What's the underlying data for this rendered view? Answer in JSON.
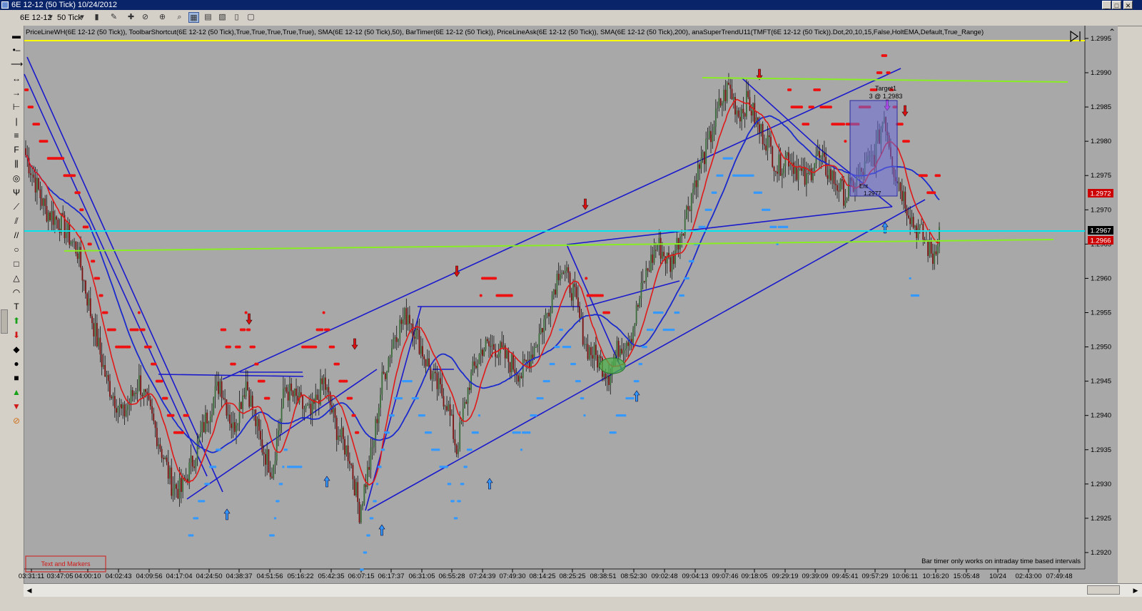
{
  "window": {
    "title": "6E 12-12 (50 Tick)  10/24/2012",
    "controls": [
      "_",
      "□",
      "✕"
    ]
  },
  "toolbar": {
    "instrument": "6E 12-12",
    "interval": "50 Tick"
  },
  "indicator_legend": "PriceLineWH(6E 12-12 (50 Tick)), ToolbarShortcut(6E 12-12 (50 Tick),True,True,True,True,True), SMA(6E 12-12 (50 Tick),50), BarTimer(6E 12-12 (50 Tick)), PriceLineAsk(6E 12-12 (50 Tick)), SMA(6E 12-12 (50 Tick),200), anaSuperTrendU11(TMFT(6E 12-12 (50 Tick)).Dot,20,10,15,False,HoltEMA,Default,True_Range)",
  "bar_timer_message": "Bar timer only works on intraday time based intervals",
  "text_markers_box": "Text and Markers",
  "trade_marker": {
    "label": "Target1",
    "detail": "3 @ 1.2983"
  },
  "entry_marker": {
    "label": "Ent",
    "detail": "1.2977"
  },
  "colors": {
    "background": "#a8a8a8",
    "bull_bar": "#3a6b3a",
    "bear_bar": "#7a1010",
    "sma50": "#e01818",
    "sma200": "#1a2acc",
    "supertrend_down": "#ee1111",
    "supertrend_up": "#3399ff",
    "ask_line": "#00e5ee",
    "lime_line": "#88ee22",
    "yellow_line": "#ffff00",
    "trendline": "#1a1acc"
  },
  "chart_data": {
    "type": "candlestick",
    "instrument": "6E 12-12",
    "interval": "50 Tick",
    "y_axis": {
      "ticks": [
        1.292,
        1.2925,
        1.293,
        1.2935,
        1.294,
        1.2945,
        1.295,
        1.2955,
        1.296,
        1.2965,
        1.297,
        1.2975,
        1.298,
        1.2985,
        1.299,
        1.2995
      ],
      "range": [
        1.2919,
        1.2996
      ]
    },
    "x_axis": {
      "tick_labels": [
        "03:31:11",
        "03:47:05",
        "04:00:10",
        "04:02:43",
        "04:09:56",
        "04:17:04",
        "04:24:50",
        "04:38:37",
        "04:51:56",
        "05:16:22",
        "05:42:35",
        "06:07:15",
        "06:17:37",
        "06:31:05",
        "06:55:28",
        "07:24:39",
        "07:49:30",
        "08:14:25",
        "08:25:25",
        "08:38:51",
        "08:52:30",
        "09:02:48",
        "09:04:13",
        "09:07:46",
        "09:18:05",
        "09:29:19",
        "09:39:09",
        "09:45:41",
        "09:57:29",
        "10:06:11",
        "10:16:20",
        "15:05:48",
        "10/24",
        "02:43:00",
        "07:49:48"
      ]
    },
    "price_labels": {
      "last": "1.2967",
      "bid": "1.2966",
      "sma": "1.2972"
    },
    "close_path": [
      [
        0,
        1.2978
      ],
      [
        12,
        1.297
      ],
      [
        22,
        1.2968
      ],
      [
        32,
        1.2964
      ],
      [
        40,
        1.2955
      ],
      [
        50,
        1.2945
      ],
      [
        60,
        1.294
      ],
      [
        70,
        1.2945
      ],
      [
        80,
        1.2938
      ],
      [
        90,
        1.293
      ],
      [
        96,
        1.2929
      ],
      [
        104,
        1.2934
      ],
      [
        112,
        1.294
      ],
      [
        120,
        1.2945
      ],
      [
        128,
        1.2938
      ],
      [
        136,
        1.2945
      ],
      [
        145,
        1.2936
      ],
      [
        152,
        1.2932
      ],
      [
        160,
        1.2944
      ],
      [
        168,
        1.2942
      ],
      [
        176,
        1.294
      ],
      [
        184,
        1.2945
      ],
      [
        192,
        1.2938
      ],
      [
        200,
        1.2934
      ],
      [
        206,
        1.2926
      ],
      [
        214,
        1.2935
      ],
      [
        220,
        1.2945
      ],
      [
        228,
        1.2952
      ],
      [
        236,
        1.2955
      ],
      [
        244,
        1.295
      ],
      [
        252,
        1.2945
      ],
      [
        260,
        1.2942
      ],
      [
        266,
        1.2935
      ],
      [
        274,
        1.2945
      ],
      [
        282,
        1.295
      ],
      [
        290,
        1.295
      ],
      [
        298,
        1.2948
      ],
      [
        306,
        1.2946
      ],
      [
        314,
        1.295
      ],
      [
        322,
        1.2955
      ],
      [
        330,
        1.2962
      ],
      [
        338,
        1.2958
      ],
      [
        346,
        1.295
      ],
      [
        354,
        1.2948
      ],
      [
        360,
        1.2946
      ],
      [
        366,
        1.295
      ],
      [
        374,
        1.2952
      ],
      [
        382,
        1.296
      ],
      [
        390,
        1.2965
      ],
      [
        398,
        1.2962
      ],
      [
        406,
        1.2968
      ],
      [
        414,
        1.2975
      ],
      [
        422,
        1.298
      ],
      [
        428,
        1.2985
      ],
      [
        434,
        1.2988
      ],
      [
        440,
        1.2984
      ],
      [
        446,
        1.2986
      ],
      [
        452,
        1.2982
      ],
      [
        458,
        1.298
      ],
      [
        464,
        1.2976
      ],
      [
        470,
        1.2978
      ],
      [
        476,
        1.2976
      ],
      [
        482,
        1.2974
      ],
      [
        488,
        1.2978
      ],
      [
        494,
        1.2976
      ],
      [
        500,
        1.2974
      ],
      [
        506,
        1.2972
      ],
      [
        512,
        1.2974
      ],
      [
        518,
        1.2976
      ],
      [
        524,
        1.2978
      ],
      [
        530,
        1.2984
      ],
      [
        536,
        1.2976
      ],
      [
        542,
        1.2972
      ],
      [
        548,
        1.2968
      ],
      [
        554,
        1.2966
      ],
      [
        560,
        1.2963
      ],
      [
        564,
        1.2967
      ]
    ],
    "series": [
      {
        "name": "SMA(6E 12-12 (50 Tick),50)"
      },
      {
        "name": "SMA(6E 12-12 (50 Tick),200)"
      },
      {
        "name": "anaSuperTrendU11"
      }
    ]
  }
}
